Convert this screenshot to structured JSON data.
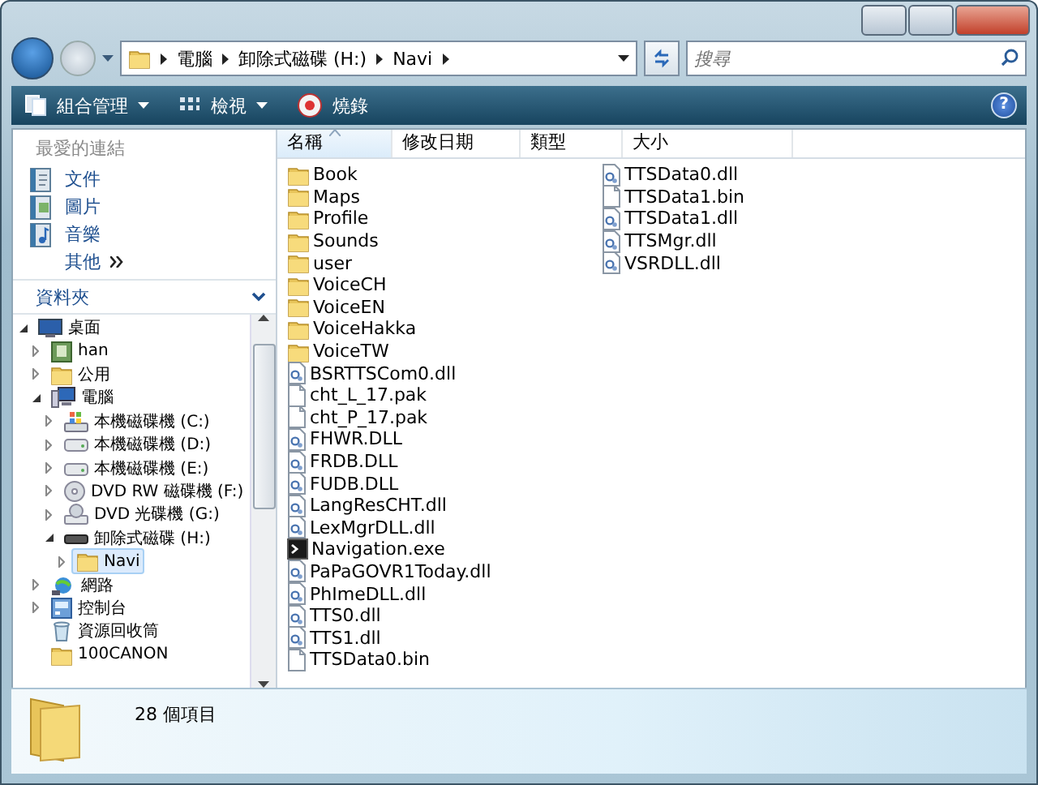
{
  "address": {
    "segments": [
      "電腦",
      "卸除式磁碟 (H:)",
      "Navi"
    ]
  },
  "search": {
    "placeholder": "搜尋"
  },
  "toolbar": {
    "buttons": [
      {
        "label": "組合管理",
        "kind": "organize",
        "dropdown": true
      },
      {
        "label": "檢視",
        "kind": "views",
        "dropdown": true
      },
      {
        "label": "燒錄",
        "kind": "burn",
        "dropdown": false
      }
    ],
    "help": "?"
  },
  "favorites": {
    "title": "最愛的連結",
    "items": [
      {
        "label": "文件",
        "kind": "documents"
      },
      {
        "label": "圖片",
        "kind": "pictures"
      },
      {
        "label": "音樂",
        "kind": "music"
      }
    ],
    "more": "其他"
  },
  "folders": {
    "title": "資料夾",
    "tree": [
      {
        "label": "桌面",
        "kind": "desktop",
        "expanded": true,
        "selected": false,
        "children": [
          {
            "label": "han",
            "kind": "user",
            "expanded": false,
            "selected": false
          },
          {
            "label": "公用",
            "kind": "folder",
            "expanded": false,
            "selected": false
          },
          {
            "label": "電腦",
            "kind": "computer",
            "expanded": true,
            "selected": false,
            "children": [
              {
                "label": "本機磁碟機 (C:)",
                "kind": "system-drive",
                "expanded": false,
                "selected": false
              },
              {
                "label": "本機磁碟機 (D:)",
                "kind": "drive",
                "expanded": false,
                "selected": false
              },
              {
                "label": "本機磁碟機 (E:)",
                "kind": "drive",
                "expanded": false,
                "selected": false
              },
              {
                "label": "DVD RW 磁碟機 (F:)",
                "kind": "disc",
                "expanded": false,
                "selected": false
              },
              {
                "label": "DVD 光碟機 (G:)",
                "kind": "dvd-drive",
                "expanded": false,
                "selected": false
              },
              {
                "label": "卸除式磁碟 (H:)",
                "kind": "removable",
                "expanded": true,
                "selected": false,
                "children": [
                  {
                    "label": "Navi",
                    "kind": "folder",
                    "expanded": false,
                    "selected": true
                  }
                ]
              }
            ]
          },
          {
            "label": "網路",
            "kind": "network",
            "expanded": false,
            "selected": false
          },
          {
            "label": "控制台",
            "kind": "control-panel",
            "expanded": false,
            "selected": false
          },
          {
            "label": "資源回收筒",
            "kind": "recycle",
            "selected": false
          },
          {
            "label": "100CANON",
            "kind": "folder",
            "selected": false
          }
        ]
      }
    ]
  },
  "columns": [
    {
      "label": "名稱",
      "sorted": true
    },
    {
      "label": "修改日期",
      "sorted": false
    },
    {
      "label": "類型",
      "sorted": false
    },
    {
      "label": "大小",
      "sorted": false
    }
  ],
  "files": [
    {
      "name": "Book",
      "kind": "folder"
    },
    {
      "name": "Maps",
      "kind": "folder"
    },
    {
      "name": "Profile",
      "kind": "folder"
    },
    {
      "name": "Sounds",
      "kind": "folder"
    },
    {
      "name": "user",
      "kind": "folder"
    },
    {
      "name": "VoiceCH",
      "kind": "folder"
    },
    {
      "name": "VoiceEN",
      "kind": "folder"
    },
    {
      "name": "VoiceHakka",
      "kind": "folder"
    },
    {
      "name": "VoiceTW",
      "kind": "folder"
    },
    {
      "name": "BSRTTSCom0.dll",
      "kind": "dll"
    },
    {
      "name": "cht_L_17.pak",
      "kind": "file"
    },
    {
      "name": "cht_P_17.pak",
      "kind": "file"
    },
    {
      "name": "FHWR.DLL",
      "kind": "dll"
    },
    {
      "name": "FRDB.DLL",
      "kind": "dll"
    },
    {
      "name": "FUDB.DLL",
      "kind": "dll"
    },
    {
      "name": "LangResCHT.dll",
      "kind": "dll"
    },
    {
      "name": "LexMgrDLL.dll",
      "kind": "dll"
    },
    {
      "name": "Navigation.exe",
      "kind": "exe"
    },
    {
      "name": "PaPaGOVR1Today.dll",
      "kind": "dll"
    },
    {
      "name": "PhImeDLL.dll",
      "kind": "dll"
    },
    {
      "name": "TTS0.dll",
      "kind": "dll"
    },
    {
      "name": "TTS1.dll",
      "kind": "dll"
    },
    {
      "name": "TTSData0.bin",
      "kind": "file"
    },
    {
      "name": "TTSData0.dll",
      "kind": "dll"
    },
    {
      "name": "TTSData1.bin",
      "kind": "file"
    },
    {
      "name": "TTSData1.dll",
      "kind": "dll"
    },
    {
      "name": "TTSMgr.dll",
      "kind": "dll"
    },
    {
      "name": "VSRDLL.dll",
      "kind": "dll"
    }
  ],
  "status_bar": {
    "count": "28 個項目"
  }
}
